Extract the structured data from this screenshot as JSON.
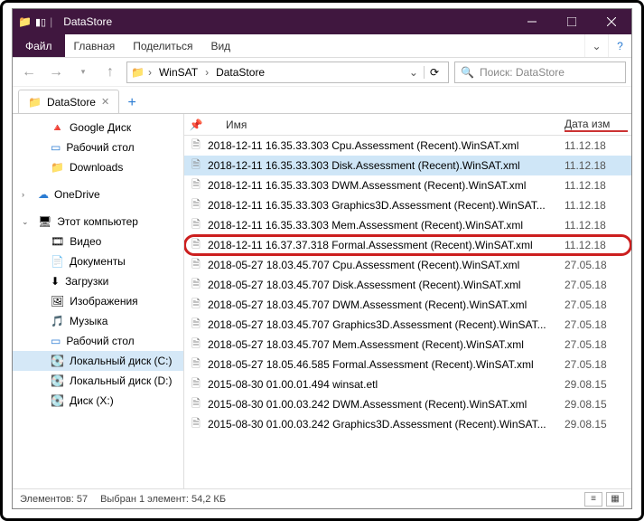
{
  "title": "DataStore",
  "menu": {
    "file": "Файл",
    "home": "Главная",
    "share": "Поделиться",
    "view": "Вид"
  },
  "breadcrumb": {
    "seg1": "WinSAT",
    "seg2": "DataStore"
  },
  "search_placeholder": "Поиск: DataStore",
  "tab": {
    "label": "DataStore"
  },
  "columns": {
    "name": "Имя",
    "date": "Дата изм"
  },
  "sidebar": {
    "google_drive": "Google Диск",
    "desktop": "Рабочий стол",
    "downloads": "Downloads",
    "onedrive": "OneDrive",
    "this_pc": "Этот компьютер",
    "videos": "Видео",
    "documents": "Документы",
    "downloads2": "Загрузки",
    "pictures": "Изображения",
    "music": "Музыка",
    "desktop2": "Рабочий стол",
    "disk_c": "Локальный диск (C:)",
    "disk_d": "Локальный диск (D:)",
    "disk_x": "Диск (X:)"
  },
  "files": [
    {
      "name": "2018-12-11 16.35.33.303 Cpu.Assessment (Recent).WinSAT.xml",
      "date": "11.12.18"
    },
    {
      "name": "2018-12-11 16.35.33.303 Disk.Assessment (Recent).WinSAT.xml",
      "date": "11.12.18",
      "selected": true
    },
    {
      "name": "2018-12-11 16.35.33.303 DWM.Assessment (Recent).WinSAT.xml",
      "date": "11.12.18"
    },
    {
      "name": "2018-12-11 16.35.33.303 Graphics3D.Assessment (Recent).WinSAT...",
      "date": "11.12.18"
    },
    {
      "name": "2018-12-11 16.35.33.303 Mem.Assessment (Recent).WinSAT.xml",
      "date": "11.12.18"
    },
    {
      "name": "2018-12-11 16.37.37.318 Formal.Assessment (Recent).WinSAT.xml",
      "date": "11.12.18",
      "highlight": true
    },
    {
      "name": "2018-05-27 18.03.45.707 Cpu.Assessment (Recent).WinSAT.xml",
      "date": "27.05.18"
    },
    {
      "name": "2018-05-27 18.03.45.707 Disk.Assessment (Recent).WinSAT.xml",
      "date": "27.05.18"
    },
    {
      "name": "2018-05-27 18.03.45.707 DWM.Assessment (Recent).WinSAT.xml",
      "date": "27.05.18"
    },
    {
      "name": "2018-05-27 18.03.45.707 Graphics3D.Assessment (Recent).WinSAT...",
      "date": "27.05.18"
    },
    {
      "name": "2018-05-27 18.03.45.707 Mem.Assessment (Recent).WinSAT.xml",
      "date": "27.05.18"
    },
    {
      "name": "2018-05-27 18.05.46.585 Formal.Assessment (Recent).WinSAT.xml",
      "date": "27.05.18"
    },
    {
      "name": "2015-08-30 01.00.01.494 winsat.etl",
      "date": "29.08.15"
    },
    {
      "name": "2015-08-30 01.00.03.242 DWM.Assessment (Recent).WinSAT.xml",
      "date": "29.08.15"
    },
    {
      "name": "2015-08-30 01.00.03.242 Graphics3D.Assessment (Recent).WinSAT...",
      "date": "29.08.15"
    }
  ],
  "status": {
    "count_label": "Элементов: 57",
    "sel_label": "Выбран 1 элемент: 54,2 КБ"
  }
}
